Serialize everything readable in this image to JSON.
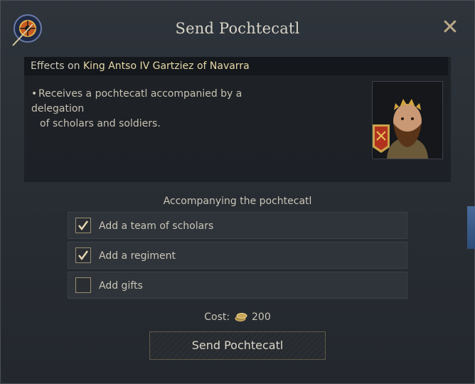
{
  "window": {
    "title": "Send Pochtecatl",
    "close_icon": "close-icon",
    "medallion_icon": "spear-shield-icon"
  },
  "effects": {
    "prefix": "Effects on",
    "target": "King Antso IV Gartziez of Navarra",
    "bullet": "•",
    "line1": "Receives a pochtecatl accompanied by a delegation",
    "line2": "of scholars and soldiers."
  },
  "accompany": {
    "label": "Accompanying the pochtecatl",
    "options": [
      {
        "label": "Add a team of scholars",
        "checked": true
      },
      {
        "label": "Add a regiment",
        "checked": true
      },
      {
        "label": "Add gifts",
        "checked": false
      }
    ]
  },
  "cost": {
    "label": "Cost:",
    "value": "200",
    "icon": "gold-coins-icon"
  },
  "action": {
    "send_label": "Send Pochtecatl"
  },
  "colors": {
    "accent_gold": "#e7d9a8",
    "background": "#2b3036"
  }
}
